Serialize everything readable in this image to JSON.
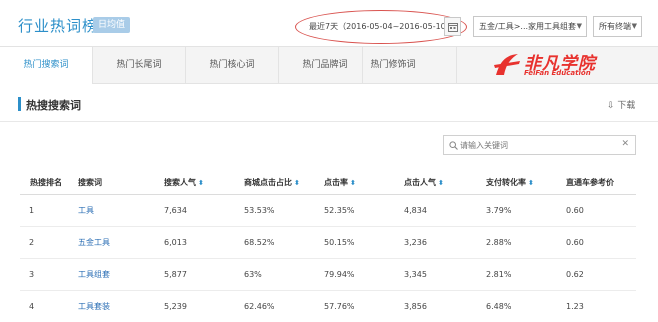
{
  "header": {
    "title": "行业热词榜",
    "badge": "日均值",
    "date_range": "最近7天（2016-05-04~2016-05-10）",
    "category_select": "五金/工具>...家用工具组套",
    "terminal_select": "所有终端"
  },
  "tabs": [
    {
      "label": "热门搜索词",
      "active": true
    },
    {
      "label": "热门长尾词",
      "active": false
    },
    {
      "label": "热门核心词",
      "active": false
    },
    {
      "label": "热门品牌词",
      "active": false
    },
    {
      "label": "热门修饰词",
      "active": false
    }
  ],
  "watermark": {
    "cn": "非凡学院",
    "en": "FeiFan Education"
  },
  "section": {
    "title": "热搜搜索词",
    "download": "下载",
    "search_placeholder": "请输入关键词"
  },
  "table": {
    "headers": [
      "热搜排名",
      "搜索词",
      "搜索人气",
      "商城点击占比",
      "点击率",
      "点击人气",
      "支付转化率",
      "直通车参考价"
    ],
    "rows": [
      {
        "rank": "1",
        "keyword": "工具",
        "popularity": "7,634",
        "mall_ratio": "53.53%",
        "ctr": "52.35%",
        "click_pop": "4,834",
        "conv": "3.79%",
        "ref_price": "0.60"
      },
      {
        "rank": "2",
        "keyword": "五金工具",
        "popularity": "6,013",
        "mall_ratio": "68.52%",
        "ctr": "50.15%",
        "click_pop": "3,236",
        "conv": "2.88%",
        "ref_price": "0.60"
      },
      {
        "rank": "3",
        "keyword": "工具组套",
        "popularity": "5,877",
        "mall_ratio": "63%",
        "ctr": "79.94%",
        "click_pop": "3,345",
        "conv": "2.81%",
        "ref_price": "0.62"
      },
      {
        "rank": "4",
        "keyword": "工具套装",
        "popularity": "5,239",
        "mall_ratio": "62.46%",
        "ctr": "57.76%",
        "click_pop": "3,856",
        "conv": "6.48%",
        "ref_price": "1.23"
      }
    ]
  },
  "colors": {
    "accent": "#2c8fc9",
    "highlight_oval": "#d9534f",
    "watermark": "#e8322e"
  }
}
